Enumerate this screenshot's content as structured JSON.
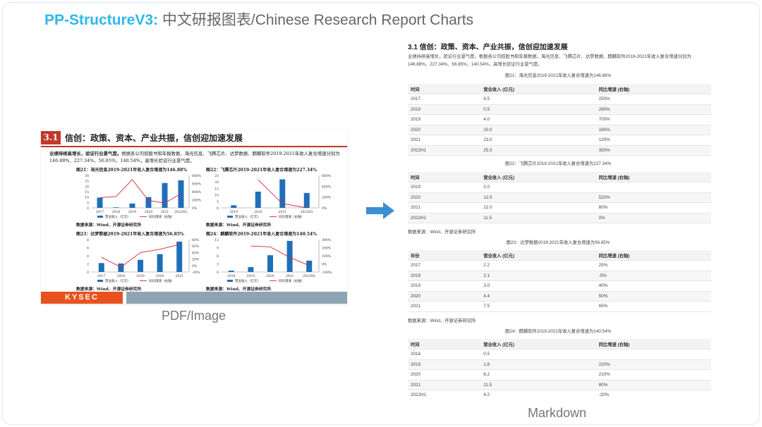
{
  "header": {
    "brand": "PP-StructureV3:",
    "title": " 中文研报图表/Chinese Research Report Charts"
  },
  "doc": {
    "section_number": "3.1",
    "section_title": "信创：政策、资本、产业共振，信创迎加速发展",
    "para_bold": "业绩持续高增长，验证行业景气度。",
    "para_rest": "根据各公司招股书和年报数据，海光信息、飞腾芯片、达梦数据、麒麟软件2019-2021年收入复合增速分别为146.88%、227.34%、56.85%、140.54%，高增长验证行业景气度。",
    "charts": [
      {
        "title": "图21：海光信息2019-2021年收入复合增速为146.88%",
        "categories": [
          "2017",
          "2018",
          "2019",
          "2020",
          "2021",
          "2022H1"
        ],
        "bars": [
          9.5,
          0.5,
          4.0,
          10.0,
          23.0,
          25.5
        ],
        "line": [
          250,
          280,
          700,
          180,
          120,
          350
        ],
        "left_ticks": [
          "0",
          "5",
          "10",
          "15",
          "20",
          "25",
          "30"
        ],
        "left_max": 30,
        "right_ticks": [
          "0%",
          "200%",
          "400%",
          "600%",
          "800%"
        ],
        "right_min": 0,
        "right_max": 800,
        "legend_bar": "营业收入（亿元）",
        "legend_line": "同比增速（右轴）",
        "source": "数据来源：Wind、开源证券研究所"
      },
      {
        "title": "图22：飞腾芯片2019-2021年收入复合增速为227.34%",
        "categories": [
          "2019",
          "2020",
          "2021",
          "2022H1"
        ],
        "bars": [
          2.0,
          12.5,
          22.0,
          11.5
        ],
        "line": [
          null,
          520,
          80,
          0
        ],
        "left_ticks": [
          "0",
          "5",
          "10",
          "15",
          "20",
          "25"
        ],
        "left_max": 25,
        "right_ticks": [
          "0%",
          "200%",
          "400%",
          "600%"
        ],
        "right_min": 0,
        "right_max": 600,
        "legend_bar": "营业收入（亿元）",
        "legend_line": "同比增速（右轴）",
        "source": "数据来源：Wind、开源证券研究所"
      },
      {
        "title": "图23：达梦数据2019-2021年收入复合增速为56.85%",
        "categories": [
          "2017",
          "2018",
          "2019",
          "2020",
          "2021"
        ],
        "bars": [
          2.2,
          2.1,
          3.0,
          4.4,
          7.5
        ],
        "line": [
          25,
          -5,
          40,
          50,
          65
        ],
        "left_ticks": [
          "0",
          "2",
          "4",
          "6",
          "8"
        ],
        "left_max": 8,
        "right_ticks": [
          "-20%",
          "0%",
          "20%",
          "40%",
          "60%",
          "80%"
        ],
        "right_min": -20,
        "right_max": 80,
        "legend_bar": "营业收入（亿元）",
        "legend_line": "同比增速（右轴）",
        "source": "数据来源：Wind、开源证券研究所"
      },
      {
        "title": "图24：麒麟软件2019-2021年收入复合增速为140.54%",
        "categories": [
          "2018",
          "2019",
          "2020",
          "2021",
          "2022H1"
        ],
        "bars": [
          0.5,
          1.8,
          6.2,
          11.5,
          4.2
        ],
        "line": [
          null,
          220,
          210,
          80,
          -20
        ],
        "left_ticks": [
          "0",
          "3",
          "6",
          "9",
          "12"
        ],
        "left_max": 12,
        "right_ticks": [
          "-100%",
          "0%",
          "100%",
          "200%",
          "300%"
        ],
        "right_min": -100,
        "right_max": 300,
        "legend_bar": "营业收入（亿元）",
        "legend_line": "同比增速（右轴）",
        "source": "数据来源：Wind、开源证券研究所"
      }
    ],
    "footer_logo": "KYSEC"
  },
  "label_pdf": "PDF/Image",
  "label_md": "Markdown",
  "colors": {
    "brand": "#31b7ea",
    "accent_red": "#c0392b",
    "bar_blue": "#1f6fb8",
    "line_red": "#d7263d",
    "arrow": "#3a8fd1"
  },
  "markdown": {
    "heading": "3.1 信创：政策、资本、产业共振，信创迎加速发展",
    "paragraph": "业绩持续高增长，验证行业景气度。根据各公司招股书和年报数据，海光信息、飞腾芯片、达梦数据、麒麟软件2019-2021年收入复合增速分别为146.88%、227.34%、56.85%、140.54%，高增长验证行业景气度。",
    "tables": [
      {
        "caption": "图21：海光信息2019-2021年收入复合增速为146.88%",
        "headers": [
          "时间",
          "营业收入 (亿元)",
          "同比增速 (右轴)"
        ],
        "rows": [
          [
            "2017",
            "9.5",
            "250%"
          ],
          [
            "2018",
            "0.5",
            "280%"
          ],
          [
            "2019",
            "4.0",
            "700%"
          ],
          [
            "2020",
            "10.0",
            "180%"
          ],
          [
            "2021",
            "23.0",
            "120%"
          ],
          [
            "2022H1",
            "25.5",
            "350%"
          ]
        ],
        "source": ""
      },
      {
        "caption": "图22：飞腾芯片2019-2021年收入复合增速为227.34%",
        "headers": [
          "时间",
          "营业收入 (亿元)",
          "同比增速 (右轴)"
        ],
        "rows": [
          [
            "2019",
            "2.0",
            ""
          ],
          [
            "2020",
            "12.5",
            "520%"
          ],
          [
            "2021",
            "22.0",
            "80%"
          ],
          [
            "2022H1",
            "11.5",
            "0%"
          ]
        ],
        "source": "数据来源：Wind、开源证券研究所"
      },
      {
        "caption": "图23：达梦数据2019-2021年收入复合增速为56.85%",
        "headers": [
          "年份",
          "营业收入 (亿元)",
          "同比增速 (右轴)"
        ],
        "rows": [
          [
            "2017",
            "2.2",
            "25%"
          ],
          [
            "2018",
            "2.1",
            "-5%"
          ],
          [
            "2019",
            "3.0",
            "40%"
          ],
          [
            "2020",
            "4.4",
            "50%"
          ],
          [
            "2021",
            "7.5",
            "65%"
          ]
        ],
        "source": "数据来源：Wind、开源证券研究所"
      },
      {
        "caption": "图24：麒麟软件2019-2021年收入复合增速为140.54%",
        "headers": [
          "时间",
          "营业收入 (亿元)",
          "同比增速 (右轴)"
        ],
        "rows": [
          [
            "2018",
            "0.5",
            ""
          ],
          [
            "2019",
            "1.8",
            "220%"
          ],
          [
            "2020",
            "6.2",
            "210%"
          ],
          [
            "2021",
            "11.5",
            "80%"
          ],
          [
            "2022H1",
            "4.2",
            "-20%"
          ]
        ],
        "source": ""
      }
    ]
  }
}
